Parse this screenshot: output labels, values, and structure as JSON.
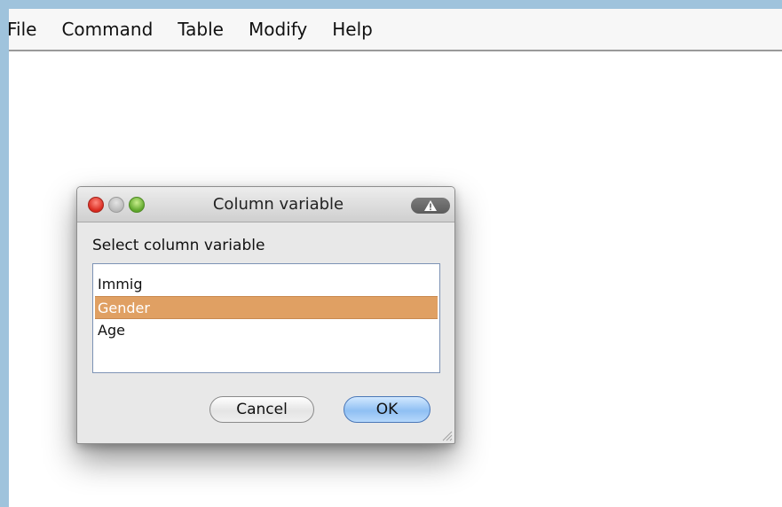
{
  "menubar": {
    "items": [
      "File",
      "Command",
      "Table",
      "Modify",
      "Help"
    ]
  },
  "dialog": {
    "title": "Column variable",
    "prompt": "Select column variable",
    "options": [
      "Immig",
      "Gender",
      "Age"
    ],
    "selected_option": "Gender",
    "buttons": {
      "cancel": "Cancel",
      "ok": "OK"
    }
  },
  "icons": {
    "window_controls": [
      "close-icon",
      "minimize-icon",
      "zoom-icon"
    ],
    "alert": "warning-icon",
    "resize": "resize-grip-icon"
  },
  "colors": {
    "selection": "#e0a063",
    "default_button": "#8fbff3",
    "desktop": "#9fc3dc"
  }
}
